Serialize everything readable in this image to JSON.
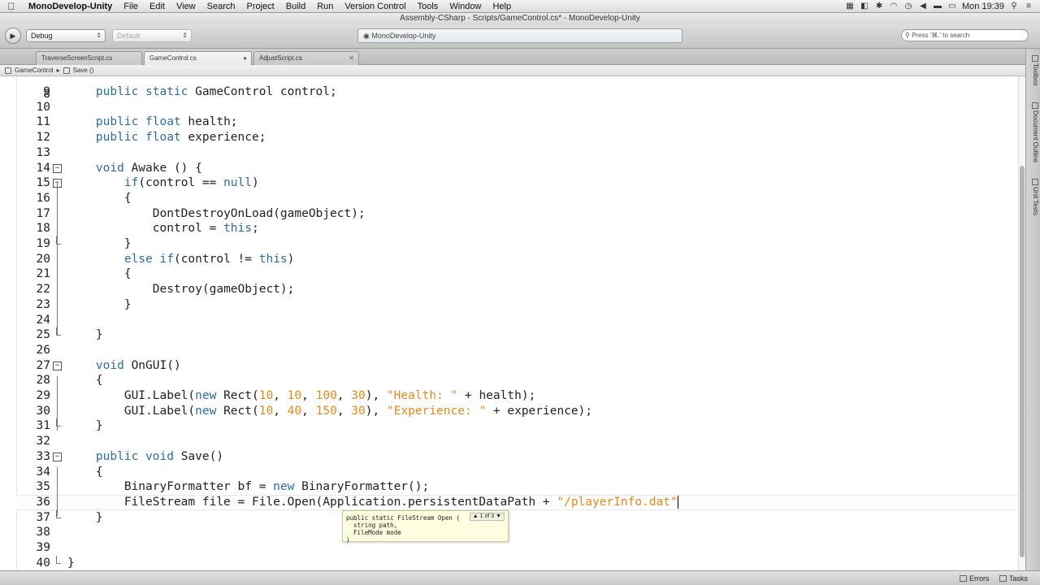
{
  "menubar": {
    "app": "MonoDevelop-Unity",
    "items": [
      "File",
      "Edit",
      "View",
      "Search",
      "Project",
      "Build",
      "Run",
      "Version Control",
      "Tools",
      "Window",
      "Help"
    ],
    "clock": "Mon 19:39"
  },
  "window": {
    "title": "Assembly-CSharp - Scripts/GameControl.cs* - MonoDevelop-Unity"
  },
  "toolbar": {
    "config": "Debug",
    "platform": "Default",
    "status": "MonoDevelop-Unity",
    "search_placeholder": "Press '⌘.' to search"
  },
  "tabs": [
    {
      "label": "TraverseScreenScript.cs"
    },
    {
      "label": "GameControl.cs"
    },
    {
      "label": "AdjustScript.cs"
    }
  ],
  "breadcrumb": {
    "class": "GameControl",
    "method": "Save ()"
  },
  "editor": {
    "partial_line": "8",
    "lines": [
      {
        "n": "9",
        "indent": "    ",
        "tokens": [
          [
            "kw",
            "public "
          ],
          [
            "kw",
            "static "
          ],
          [
            "t",
            "GameControl control;"
          ]
        ]
      },
      {
        "n": "10",
        "indent": "",
        "tokens": []
      },
      {
        "n": "11",
        "indent": "    ",
        "tokens": [
          [
            "kw",
            "public "
          ],
          [
            "kw",
            "float "
          ],
          [
            "t",
            "health;"
          ]
        ]
      },
      {
        "n": "12",
        "indent": "    ",
        "tokens": [
          [
            "kw",
            "public "
          ],
          [
            "kw",
            "float "
          ],
          [
            "t",
            "experience;"
          ]
        ]
      },
      {
        "n": "13",
        "indent": "",
        "tokens": []
      },
      {
        "n": "14",
        "indent": "    ",
        "tokens": [
          [
            "kw",
            "void "
          ],
          [
            "t",
            "Awake () {"
          ]
        ]
      },
      {
        "n": "15",
        "indent": "        ",
        "tokens": [
          [
            "kw",
            "if"
          ],
          [
            "t",
            "(control == "
          ],
          [
            "kw",
            "null"
          ],
          [
            "t",
            ")"
          ]
        ]
      },
      {
        "n": "16",
        "indent": "        ",
        "tokens": [
          [
            "t",
            "{"
          ]
        ]
      },
      {
        "n": "17",
        "indent": "            ",
        "tokens": [
          [
            "t",
            "DontDestroyOnLoad(gameObject);"
          ]
        ]
      },
      {
        "n": "18",
        "indent": "            ",
        "tokens": [
          [
            "t",
            "control = "
          ],
          [
            "kw",
            "this"
          ],
          [
            "t",
            ";"
          ]
        ]
      },
      {
        "n": "19",
        "indent": "        ",
        "tokens": [
          [
            "t",
            "}"
          ]
        ]
      },
      {
        "n": "20",
        "indent": "        ",
        "tokens": [
          [
            "kw",
            "else "
          ],
          [
            "kw",
            "if"
          ],
          [
            "t",
            "(control != "
          ],
          [
            "kw",
            "this"
          ],
          [
            "t",
            ")"
          ]
        ]
      },
      {
        "n": "21",
        "indent": "        ",
        "tokens": [
          [
            "t",
            "{"
          ]
        ]
      },
      {
        "n": "22",
        "indent": "            ",
        "tokens": [
          [
            "t",
            "Destroy(gameObject);"
          ]
        ]
      },
      {
        "n": "23",
        "indent": "        ",
        "tokens": [
          [
            "t",
            "}"
          ]
        ]
      },
      {
        "n": "24",
        "indent": "",
        "tokens": []
      },
      {
        "n": "25",
        "indent": "    ",
        "tokens": [
          [
            "t",
            "}"
          ]
        ]
      },
      {
        "n": "26",
        "indent": "",
        "tokens": []
      },
      {
        "n": "27",
        "indent": "    ",
        "tokens": [
          [
            "kw",
            "void "
          ],
          [
            "t",
            "OnGUI()"
          ]
        ]
      },
      {
        "n": "28",
        "indent": "    ",
        "tokens": [
          [
            "t",
            "{"
          ]
        ]
      },
      {
        "n": "29",
        "indent": "        ",
        "tokens": [
          [
            "t",
            "GUI.Label("
          ],
          [
            "kw",
            "new "
          ],
          [
            "t",
            "Rect("
          ],
          [
            "num",
            "10"
          ],
          [
            "t",
            ", "
          ],
          [
            "num",
            "10"
          ],
          [
            "t",
            ", "
          ],
          [
            "num",
            "100"
          ],
          [
            "t",
            ", "
          ],
          [
            "num",
            "30"
          ],
          [
            "t",
            "), "
          ],
          [
            "str",
            "\"Health: \""
          ],
          [
            "t",
            " + health);"
          ]
        ]
      },
      {
        "n": "30",
        "indent": "        ",
        "tokens": [
          [
            "t",
            "GUI.Label("
          ],
          [
            "kw",
            "new "
          ],
          [
            "t",
            "Rect("
          ],
          [
            "num",
            "10"
          ],
          [
            "t",
            ", "
          ],
          [
            "num",
            "40"
          ],
          [
            "t",
            ", "
          ],
          [
            "num",
            "150"
          ],
          [
            "t",
            ", "
          ],
          [
            "num",
            "30"
          ],
          [
            "t",
            "), "
          ],
          [
            "str",
            "\"Experience: \""
          ],
          [
            "t",
            " + experience);"
          ]
        ]
      },
      {
        "n": "31",
        "indent": "    ",
        "tokens": [
          [
            "t",
            "}"
          ]
        ]
      },
      {
        "n": "32",
        "indent": "",
        "tokens": []
      },
      {
        "n": "33",
        "indent": "    ",
        "tokens": [
          [
            "kw",
            "public "
          ],
          [
            "kw",
            "void "
          ],
          [
            "t",
            "Save()"
          ]
        ]
      },
      {
        "n": "34",
        "indent": "    ",
        "tokens": [
          [
            "t",
            "{"
          ]
        ]
      },
      {
        "n": "35",
        "indent": "        ",
        "tokens": [
          [
            "t",
            "BinaryFormatter bf = "
          ],
          [
            "kw",
            "new "
          ],
          [
            "t",
            "BinaryFormatter();"
          ]
        ]
      },
      {
        "n": "36",
        "indent": "        ",
        "tokens": [
          [
            "t",
            "FileStream file = File.Open(Application.persistentDataPath + "
          ],
          [
            "str",
            "\"/playerInfo.dat\""
          ]
        ]
      },
      {
        "n": "37",
        "indent": "    ",
        "tokens": [
          [
            "t",
            "}"
          ]
        ]
      },
      {
        "n": "38",
        "indent": "",
        "tokens": []
      },
      {
        "n": "39",
        "indent": "",
        "tokens": []
      },
      {
        "n": "40",
        "indent": "",
        "tokens": [
          [
            "t",
            "}"
          ]
        ]
      }
    ]
  },
  "tooltip": {
    "lines": [
      "public static FileStream Open (",
      "  string path,",
      "  FileMode mode",
      ")"
    ],
    "overload": "▲ 1 of 3 ▼"
  },
  "dock": [
    "Toolbox",
    "Document Outline",
    "Unit Tests"
  ],
  "statusbar": {
    "errors": "Errors",
    "tasks": "Tasks"
  },
  "colors": {
    "keyword": "#2b6e9e",
    "literal": "#e58a1c",
    "text": "#222222"
  }
}
